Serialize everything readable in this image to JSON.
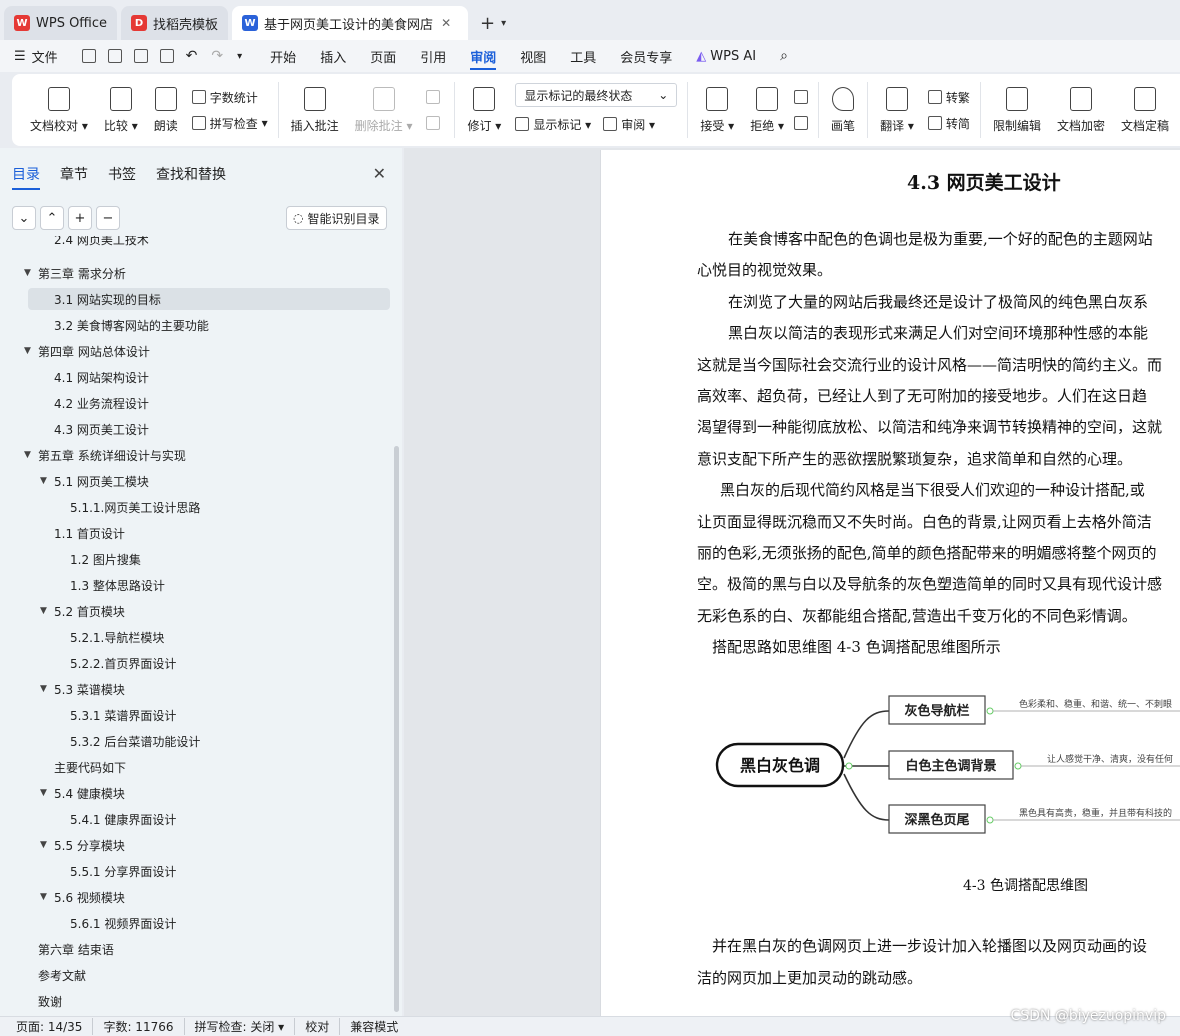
{
  "tabs": [
    {
      "label": "WPS Office",
      "icon_color": "#e53935"
    },
    {
      "label": "找稻壳模板",
      "icon_color": "#e53935"
    },
    {
      "label": "基于网页美工设计的美食网店",
      "icon_color": "#2b62d9"
    }
  ],
  "menu": {
    "file": "文件",
    "items": [
      "开始",
      "插入",
      "页面",
      "引用",
      "审阅",
      "视图",
      "工具",
      "会员专享"
    ],
    "active": "审阅",
    "wps_ai": "WPS AI"
  },
  "ribbon": {
    "doc_check": "文档校对",
    "compare": "比较",
    "read_aloud": "朗读",
    "word_count": "字数统计",
    "spell_check": "拼写检查",
    "insert_comment": "插入批注",
    "delete_comment": "删除批注",
    "revise": "修订",
    "markup_state": "显示标记的最终状态",
    "show_markup": "显示标记",
    "review": "审阅",
    "accept": "接受",
    "reject": "拒绝",
    "pen": "画笔",
    "translate": "翻译",
    "to_traditional": "转繁",
    "to_simplified": "转简",
    "restrict_edit": "限制编辑",
    "doc_encrypt": "文档加密",
    "doc_finalize": "文档定稿"
  },
  "sidebar": {
    "tabs": [
      "目录",
      "章节",
      "书签",
      "查找和替换"
    ],
    "smart_toc": "智能识别目录",
    "toc": [
      {
        "label": "2.4 网页美工技术",
        "level": 2,
        "tri": false
      },
      {
        "label": "第三章 需求分析",
        "level": 1,
        "tri": true
      },
      {
        "label": "3.1 网站实现的目标",
        "level": 2,
        "tri": false,
        "selected": true
      },
      {
        "label": "3.2 美食博客网站的主要功能",
        "level": 2,
        "tri": false
      },
      {
        "label": "第四章 网站总体设计",
        "level": 1,
        "tri": true
      },
      {
        "label": "4.1 网站架构设计",
        "level": 2,
        "tri": false
      },
      {
        "label": "4.2 业务流程设计",
        "level": 2,
        "tri": false
      },
      {
        "label": "4.3 网页美工设计",
        "level": 2,
        "tri": false
      },
      {
        "label": "第五章 系统详细设计与实现",
        "level": 1,
        "tri": true
      },
      {
        "label": "5.1 网页美工模块",
        "level": 2,
        "tri": true
      },
      {
        "label": "5.1.1.网页美工设计思路",
        "level": 3,
        "tri": false
      },
      {
        "label": "1.1 首页设计",
        "level": 2,
        "tri": false
      },
      {
        "label": "1.2 图片搜集",
        "level": 3,
        "tri": false
      },
      {
        "label": "1.3 整体思路设计",
        "level": 3,
        "tri": false
      },
      {
        "label": "5.2 首页模块",
        "level": 2,
        "tri": true
      },
      {
        "label": "5.2.1.导航栏模块",
        "level": 3,
        "tri": false
      },
      {
        "label": "5.2.2.首页界面设计",
        "level": 3,
        "tri": false
      },
      {
        "label": "5.3 菜谱模块",
        "level": 2,
        "tri": true
      },
      {
        "label": "5.3.1 菜谱界面设计",
        "level": 3,
        "tri": false
      },
      {
        "label": "5.3.2 后台菜谱功能设计",
        "level": 3,
        "tri": false
      },
      {
        "label": "主要代码如下",
        "level": 2,
        "tri": false
      },
      {
        "label": "5.4 健康模块",
        "level": 2,
        "tri": true
      },
      {
        "label": "5.4.1 健康界面设计",
        "level": 3,
        "tri": false
      },
      {
        "label": "5.5 分享模块",
        "level": 2,
        "tri": true
      },
      {
        "label": "5.5.1 分享界面设计",
        "level": 3,
        "tri": false
      },
      {
        "label": "5.6 视频模块",
        "level": 2,
        "tri": true
      },
      {
        "label": "5.6.1 视频界面设计",
        "level": 3,
        "tri": false
      },
      {
        "label": "第六章 结束语",
        "level": 1,
        "tri": false
      },
      {
        "label": "参考文献",
        "level": 1,
        "tri": false
      },
      {
        "label": "致谢",
        "level": 1,
        "tri": false
      }
    ]
  },
  "document": {
    "heading": "4.3 网页美工设计",
    "lines": [
      "在美食博客中配色的色调也是极为重要,一个好的配色的主题网站",
      "心悦目的视觉效果。",
      "在浏览了大量的网站后我最终还是设计了极简风的纯色黑白灰系",
      "黑白灰以简洁的表现形式来满足人们对空间环境那种性感的本能",
      "这就是当今国际社会交流行业的设计风格——简洁明快的简约主义。而",
      "高效率、超负荷，已经让人到了无可附加的接受地步。人们在这日趋",
      "渴望得到一种能彻底放松、以简洁和纯净来调节转换精神的空间，这就",
      "意识支配下所产生的恶欲摆脱繁琐复杂，追求简单和自然的心理。",
      "黑白灰的后现代简约风格是当下很受人们欢迎的一种设计搭配,或",
      "让页面显得既沉稳而又不失时尚。白色的背景,让网页看上去格外简洁",
      "丽的色彩,无须张扬的配色,简单的颜色搭配带来的明媚感将整个网页的",
      "空。极简的黑与白以及导航条的灰色塑造简单的同时又具有现代设计感",
      "无彩色系的白、灰都能组合搭配,营造出千变万化的不同色彩情调。",
      "搭配思路如思维图 4-3 色调搭配思维图所示"
    ],
    "mindmap": {
      "root": "黑白灰色调",
      "branches": [
        {
          "label": "灰色导航栏",
          "note": "色彩柔和、稳重、和谐、统一、不刺眼"
        },
        {
          "label": "白色主色调背景",
          "note": "让人感觉干净、清爽，没有任何"
        },
        {
          "label": "深黑色页尾",
          "note": "黑色具有高贵，稳重，并且带有科技的"
        }
      ]
    },
    "caption": "4-3 色调搭配思维图",
    "lines_after": [
      "并在黑白灰的色调网页上进一步设计加入轮播图以及网页动画的设",
      "洁的网页加上更加灵动的跳动感。"
    ]
  },
  "status": {
    "page": "页面: 14/35",
    "words": "字数: 11766",
    "spell": "拼写检查: 关闭",
    "proof": "校对",
    "compat": "兼容模式"
  },
  "watermark": "CSDN @biyezuopinvip"
}
